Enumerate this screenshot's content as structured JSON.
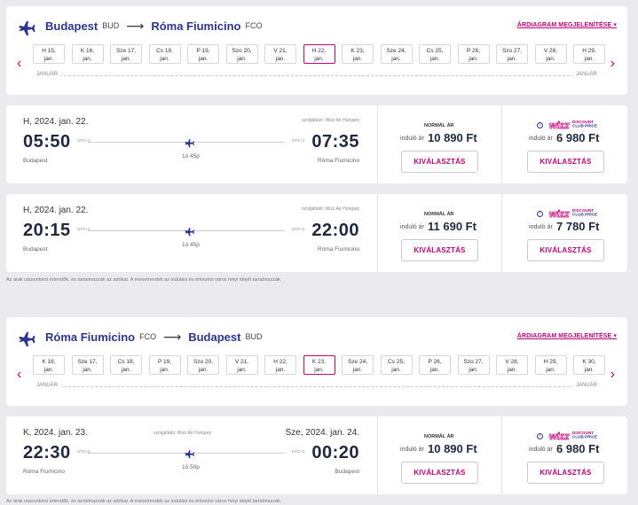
{
  "outbound": {
    "origin_city": "Budapest",
    "origin_code": "BUD",
    "dest_city": "Róma Fiumicino",
    "dest_code": "FCO",
    "diagram_link": "ÁRDIAGRAM MEGJELENÍTÉSE",
    "dates": [
      {
        "l1": "H 15,",
        "l2": "jan."
      },
      {
        "l1": "K 16,",
        "l2": "jan."
      },
      {
        "l1": "Sze 17,",
        "l2": "jan."
      },
      {
        "l1": "Cs 18,",
        "l2": "jan."
      },
      {
        "l1": "P 19,",
        "l2": "jan."
      },
      {
        "l1": "Szo 20,",
        "l2": "jan."
      },
      {
        "l1": "V 21,",
        "l2": "jan."
      },
      {
        "l1": "H 22,",
        "l2": "jan."
      },
      {
        "l1": "K 23,",
        "l2": "jan."
      },
      {
        "l1": "Sze 24,",
        "l2": "jan."
      },
      {
        "l1": "Cs 25,",
        "l2": "jan."
      },
      {
        "l1": "P 26,",
        "l2": "jan."
      },
      {
        "l1": "Szo 27,",
        "l2": "jan."
      },
      {
        "l1": "V 28,",
        "l2": "jan."
      },
      {
        "l1": "H 29,",
        "l2": "jan."
      }
    ],
    "active_index": 7,
    "month_label": "JANUÁR",
    "flights": [
      {
        "date": "H, 2024. jan. 22.",
        "operator": "szolgáltató: Wizz Air Hungary",
        "dep": "05:50",
        "arr": "07:35",
        "dep_utc": "UTC+1",
        "arr_utc": "UTC+1",
        "from": "Budapest",
        "to": "Róma Fiumicino",
        "duration": "1ó 45p",
        "normal_label": "NORMÁL ÁR",
        "from_label": "induló ár",
        "normal_price": "10 890 Ft",
        "club_price": "6 980 Ft",
        "select": "KIVÁLASZTÁS"
      },
      {
        "date": "H, 2024. jan. 22.",
        "operator": "szolgáltató: Wizz Air Hungary",
        "dep": "20:15",
        "arr": "22:00",
        "dep_utc": "UTC+1",
        "arr_utc": "UTC+1",
        "from": "Budapest",
        "to": "Róma Fiumicino",
        "duration": "1ó 45p",
        "normal_label": "NORMÁL ÁR",
        "from_label": "induló ár",
        "normal_price": "11 690 Ft",
        "club_price": "7 780 Ft",
        "select": "KIVÁLASZTÁS"
      }
    ],
    "note": "Az árak utasonként értendők, és tartalmazzák az adókat. A menetrendek az indulási és érkezési város helyi idejét tartalmazzák."
  },
  "inbound": {
    "origin_city": "Róma Fiumicino",
    "origin_code": "FCO",
    "dest_city": "Budapest",
    "dest_code": "BUD",
    "diagram_link": "ÁRDIAGRAM MEGJELENÍTÉSE",
    "dates": [
      {
        "l1": "K 16,",
        "l2": "jan."
      },
      {
        "l1": "Sze 17,",
        "l2": "jan."
      },
      {
        "l1": "Cs 18,",
        "l2": "jan."
      },
      {
        "l1": "P 19,",
        "l2": "jan."
      },
      {
        "l1": "Szo 20,",
        "l2": "jan."
      },
      {
        "l1": "V 21,",
        "l2": "jan."
      },
      {
        "l1": "H 22,",
        "l2": "jan."
      },
      {
        "l1": "K 23,",
        "l2": "jan."
      },
      {
        "l1": "Sze 24,",
        "l2": "jan."
      },
      {
        "l1": "Cs 25,",
        "l2": "jan."
      },
      {
        "l1": "P 26,",
        "l2": "jan."
      },
      {
        "l1": "Szo 27,",
        "l2": "jan."
      },
      {
        "l1": "V 28,",
        "l2": "jan."
      },
      {
        "l1": "H 29,",
        "l2": "jan."
      },
      {
        "l1": "K 30,",
        "l2": "jan."
      }
    ],
    "active_index": 7,
    "month_label": "JANUÁR",
    "flights": [
      {
        "date": "K, 2024. jan. 23.",
        "arr_date": "Sze, 2024. jan. 24.",
        "operator": "szolgáltató: Wizz Air Hungary",
        "dep": "22:30",
        "arr": "00:20",
        "dep_utc": "UTC+1",
        "arr_utc": "UTC+1",
        "from": "Róma Fiumicino",
        "to": "Budapest",
        "duration": "1ó 50p",
        "normal_label": "NORMÁL ÁR",
        "from_label": "induló ár",
        "normal_price": "10 890 Ft",
        "club_price": "6 980 Ft",
        "select": "KIVÁLASZTÁS"
      }
    ],
    "note": "Az árak utasonként értendők, és tartalmazzák az adókat. A menetrendek az indulási és érkezési város helyi idejét tartalmazzák."
  },
  "colors": {
    "brand_magenta": "#c4007a",
    "brand_navy": "#2c3590"
  }
}
